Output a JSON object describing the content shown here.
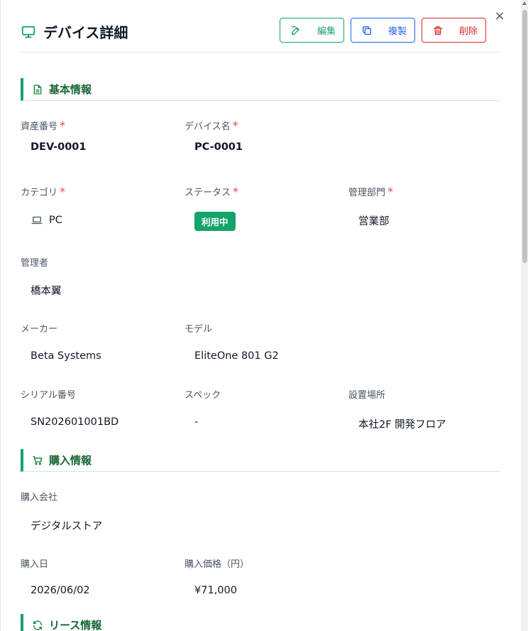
{
  "header": {
    "title": "デバイス詳細",
    "edit_label": "編集",
    "copy_label": "複製",
    "delete_label": "削除",
    "close_glyph": "×"
  },
  "sections": {
    "basic": "基本情報",
    "purchase": "購入情報",
    "lease": "リース情報"
  },
  "fields": {
    "asset_no": {
      "label": "資産番号",
      "value": "DEV-0001",
      "required": "*"
    },
    "device_name": {
      "label": "デバイス名",
      "value": "PC-0001",
      "required": "*"
    },
    "category": {
      "label": "カテゴリ",
      "value": "PC",
      "required": "*"
    },
    "status": {
      "label": "ステータス",
      "value": "利用中",
      "required": "*"
    },
    "department": {
      "label": "管理部門",
      "value": "営業部",
      "required": "*"
    },
    "manager": {
      "label": "管理者",
      "value": "橋本翼"
    },
    "maker": {
      "label": "メーカー",
      "value": "Beta Systems"
    },
    "model": {
      "label": "モデル",
      "value": "EliteOne 801 G2"
    },
    "serial": {
      "label": "シリアル番号",
      "value": "SN202601001BD"
    },
    "spec": {
      "label": "スペック",
      "value": "-"
    },
    "location": {
      "label": "設置場所",
      "value": "本社2F 開発フロア"
    },
    "vendor": {
      "label": "購入会社",
      "value": "デジタルストア"
    },
    "purchase_date": {
      "label": "購入日",
      "value": "2026/06/02"
    },
    "price": {
      "label": "購入価格（円）",
      "value": "¥71,000"
    }
  },
  "colors": {
    "accent": "#16a36a",
    "copy": "#2563eb",
    "danger": "#dc2626"
  },
  "icons": {
    "title": "monitor-icon",
    "edit": "edit-icon",
    "copy": "copy-icon",
    "delete": "trash-icon",
    "basic": "document-icon",
    "purchase": "cart-icon",
    "lease": "refresh-icon",
    "category": "laptop-icon"
  }
}
